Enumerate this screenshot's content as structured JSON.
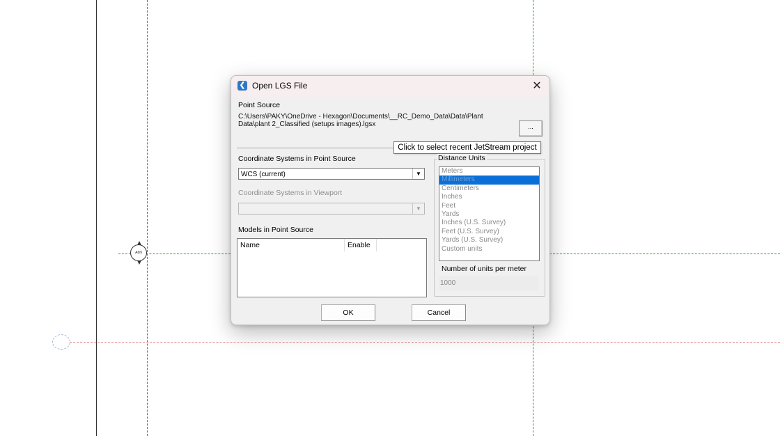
{
  "dialog": {
    "title": "Open LGS File",
    "close_glyph": "✕",
    "app_icon": "chevron-app-icon",
    "point_source_label": "Point Source",
    "point_source_path": "C:\\Users\\PAKY\\OneDrive - Hexagon\\Documents\\__RC_Demo_Data\\Data\\Plant\nData\\plant 2_Classified (setups images).lgsx",
    "browse_label": "...",
    "tooltip": "Click to select recent JetStream project",
    "coord_systems_label": "Coordinate Systems in Point Source",
    "coord_system_selected": "WCS (current)",
    "viewport_coord_label": "Coordinate Systems in Viewport",
    "viewport_coord_selected": "",
    "models_label": "Models in Point Source",
    "models_columns": [
      "Name",
      "Enable"
    ],
    "distance_units_label": "Distance Units",
    "distance_units": [
      "Meters",
      "Millimeters",
      "Centimeters",
      "Inches",
      "Feet",
      "Yards",
      "Inches (U.S. Survey)",
      "Feet (U.S. Survey)",
      "Yards (U.S. Survey)",
      "Custom units"
    ],
    "distance_units_selected_index": 1,
    "units_per_meter_label": "Number of units per meter",
    "units_per_meter_value": "1000",
    "ok_label": "OK",
    "cancel_label": "Cancel"
  },
  "canvas": {
    "level_marker_text": "A6N"
  },
  "colors": {
    "grid_green": "#2a9a2a",
    "grid_pink": "#e7a1a8",
    "selection_blue": "#0a6fd6"
  }
}
